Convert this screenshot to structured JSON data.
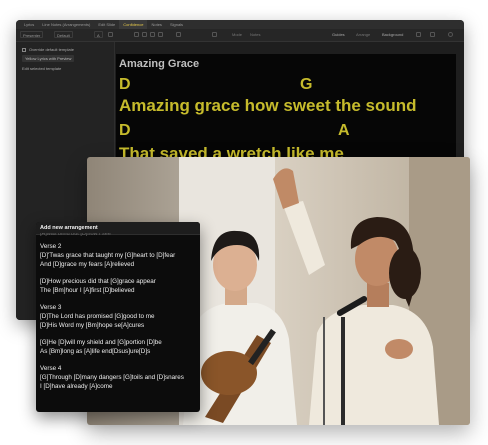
{
  "app": {
    "tabs": [
      "Lyrics",
      "Line Notes (Arrangements)",
      "Edit Slide",
      "Confidence",
      "Notes",
      "Signals"
    ],
    "active_tab": "Confidence",
    "toolbar": {
      "dropdown_left": "Presenter",
      "dropdown_2": "Default",
      "font_size": "A",
      "label_1": "Mode",
      "label_2": "Notes",
      "guides": "Guides",
      "arrange": "Arrange",
      "background": "Background"
    },
    "left_panel": {
      "override_label": "Override default template",
      "template_select": "Yellow Lyrics with Preview",
      "edit_template": "Edit selected template"
    },
    "preview": {
      "slide_title": "Amazing Grace",
      "chord_1a": "D",
      "chord_1b": "G",
      "line_1": "Amazing grace how sweet the sound",
      "chord_2a": "D",
      "chord_2b": "A",
      "line_2": "That saved a wretch like me"
    }
  },
  "arrangement_panel": {
    "title": "Add new arrangement",
    "peek_text": "[A]was blind but [D]now I see",
    "stanzas": [
      {
        "lines": [
          "Verse 2",
          "[D]'Twas grace that taught my [G]heart to [D]fear",
          "And [D]grace my fears [A]relieved"
        ]
      },
      {
        "lines": [
          "[D]How precious did that [G]grace appear",
          "The [Bm]hour I [A]first [D]believed"
        ]
      },
      {
        "lines": [
          "Verse 3",
          "[D]The Lord has promised [G]good to me",
          "[D]His Word my [Bm]hope se[A]cures"
        ]
      },
      {
        "lines": [
          "[G]He [D]will my shield and [G]portion [D]be",
          "As [Bm]long as [A]life end[Dsus]ure[D]s"
        ]
      },
      {
        "lines": [
          "Verse 4",
          "[G]Through [D]many dangers [G]toils and [D]snares",
          "I [D]have already [A]come"
        ]
      }
    ]
  },
  "colors": {
    "accent_yellow": "#c6bb2c",
    "panel_bg": "#0c0c0c",
    "app_bg": "#1e1e1e"
  }
}
